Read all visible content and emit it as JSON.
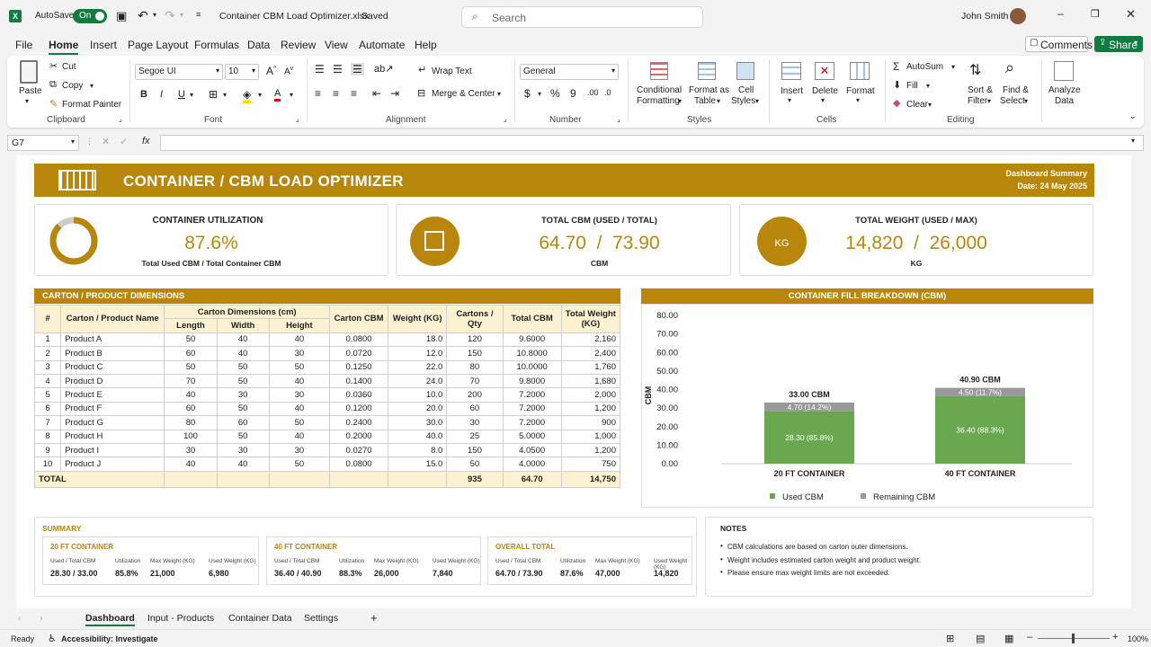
{
  "titlebar": {
    "autosave": "AutoSave",
    "toggle": "On",
    "filename": "Container CBM Load Optimizer.xlsx",
    "saved": "Saved",
    "search": "Search",
    "user": "John Smith"
  },
  "menu": [
    "File",
    "Home",
    "Insert",
    "Page Layout",
    "Formulas",
    "Data",
    "Review",
    "View",
    "Automate",
    "Help"
  ],
  "menu_actions": {
    "comments": "Comments",
    "share": "Share"
  },
  "ribbon": {
    "paste": "Paste",
    "cut": "Cut",
    "copy": "Copy",
    "format_painter": "Format Painter",
    "clipboard": "Clipboard",
    "font_name": "Segoe UI",
    "font_size": "10",
    "font": "Font",
    "wrap": "Wrap Text",
    "merge": "Merge & Center",
    "alignment": "Alignment",
    "number_format": "General",
    "number": "Number",
    "cond1": "Conditional",
    "cond2": "Formatting",
    "fat1": "Format as",
    "fat2": "Table",
    "cs1": "Cell",
    "cs2": "Styles",
    "styles": "Styles",
    "insert": "Insert",
    "delete": "Delete",
    "format": "Format",
    "cells": "Cells",
    "autosum": "AutoSum",
    "fill": "Fill",
    "clear": "Clear",
    "sort1": "Sort &",
    "sort2": "Filter",
    "find1": "Find &",
    "find2": "Select",
    "editing": "Editing",
    "analyze1": "Analyze",
    "analyze2": "Data"
  },
  "formula_bar": {
    "cell": "G7",
    "fx": "fx"
  },
  "dashboard": {
    "title": "CONTAINER / CBM LOAD OPTIMIZER",
    "summary_label": "Dashboard Summary",
    "date": "Date: 24 May 2025",
    "kpi": [
      {
        "title": "CONTAINER UTILIZATION",
        "value": "87.6%",
        "sub": "Total Used CBM / Total Container CBM",
        "pct": 0.876
      },
      {
        "title": "TOTAL CBM (USED / TOTAL)",
        "value": "64.70  /  73.90",
        "sub": "CBM",
        "icon": "box-icon"
      },
      {
        "title": "TOTAL WEIGHT (USED / MAX)",
        "value": "14,820  /  26,000",
        "sub": "KG",
        "icon": "weight-icon"
      }
    ],
    "carton_title": "CARTON / PRODUCT DIMENSIONS",
    "headers": {
      "num": "#",
      "name": "Carton / Product Name",
      "dims": "Carton Dimensions (cm)",
      "length": "Length",
      "width": "Width",
      "height": "Height",
      "cbm": "Carton CBM",
      "weight": "Weight (KG)",
      "qty": "Cartons / Qty",
      "tcbm": "Total CBM",
      "tweight": "Total Weight (KG)"
    },
    "rows": [
      [
        "1",
        "Product A",
        "50",
        "40",
        "40",
        "0.0800",
        "18.0",
        "120",
        "9.6000",
        "2,160"
      ],
      [
        "2",
        "Product B",
        "60",
        "40",
        "30",
        "0.0720",
        "12.0",
        "150",
        "10.8000",
        "2,400"
      ],
      [
        "3",
        "Product C",
        "50",
        "50",
        "50",
        "0.1250",
        "22.0",
        "80",
        "10.0000",
        "1,760"
      ],
      [
        "4",
        "Product D",
        "70",
        "50",
        "40",
        "0.1400",
        "24.0",
        "70",
        "9.8000",
        "1,680"
      ],
      [
        "5",
        "Product E",
        "40",
        "30",
        "30",
        "0.0360",
        "10.0",
        "200",
        "7.2000",
        "2,000"
      ],
      [
        "6",
        "Product F",
        "60",
        "50",
        "40",
        "0.1200",
        "20.0",
        "60",
        "7.2000",
        "1,200"
      ],
      [
        "7",
        "Product G",
        "80",
        "60",
        "50",
        "0.2400",
        "30.0",
        "30",
        "7.2000",
        "900"
      ],
      [
        "8",
        "Product H",
        "100",
        "50",
        "40",
        "0.2000",
        "40.0",
        "25",
        "5.0000",
        "1,000"
      ],
      [
        "9",
        "Product I",
        "30",
        "30",
        "30",
        "0.0270",
        "8.0",
        "150",
        "4.0500",
        "1,200"
      ],
      [
        "10",
        "Product J",
        "40",
        "40",
        "50",
        "0.0800",
        "15.0",
        "50",
        "4.0000",
        "750"
      ]
    ],
    "total": {
      "label": "TOTAL",
      "qty": "935",
      "cbm": "64.70",
      "weight": "14,750"
    },
    "chart_title": "CONTAINER FILL BREAKDOWN (CBM)",
    "summary": {
      "title": "SUMMARY",
      "blocks": [
        {
          "title": "20 FT CONTAINER",
          "h": [
            "Used / Total CBM",
            "Utilization",
            "Max Weight (KG)",
            "Used Weight (KG)"
          ],
          "v": [
            "28.30 / 33.00",
            "85.8%",
            "21,000",
            "6,980"
          ]
        },
        {
          "title": "40 FT CONTAINER",
          "h": [
            "Used / Total CBM",
            "Utilization",
            "Max Weight (KG)",
            "Used Weight (KG)"
          ],
          "v": [
            "36.40 / 40.90",
            "88.3%",
            "26,000",
            "7,840"
          ]
        },
        {
          "title": "OVERALL TOTAL",
          "h": [
            "Used / Total CBM",
            "Utilization",
            "Max Weight (KG)",
            "Used Weight (KG)"
          ],
          "v": [
            "64.70 / 73.90",
            "87.6%",
            "47,000",
            "14,820"
          ]
        }
      ]
    },
    "notes": {
      "title": "NOTES",
      "items": [
        "CBM calculations are based on carton outer dimensions.",
        "Weight includes estimated carton weight and product weight.",
        "Please ensure max weight limits are not exceeded."
      ]
    }
  },
  "chart_data": {
    "type": "bar",
    "stacked": true,
    "categories": [
      "20 FT CONTAINER",
      "40 FT CONTAINER"
    ],
    "series": [
      {
        "name": "Used CBM",
        "values": [
          28.3,
          36.4
        ],
        "labels": [
          "28.30 (85.8%)",
          "36.40 (88.3%)"
        ],
        "color": "#6aa84f"
      },
      {
        "name": "Remaining CBM",
        "values": [
          4.7,
          4.5
        ],
        "labels": [
          "4.70 (14.2%)",
          "4.50 (11.7%)"
        ],
        "color": "#999999"
      }
    ],
    "totals": [
      "33.00 CBM",
      "40.90 CBM"
    ],
    "ylabel": "CBM",
    "ylim": [
      0,
      80
    ],
    "yticks": [
      "0.00",
      "10.00",
      "20.00",
      "30.00",
      "40.00",
      "50.00",
      "60.00",
      "70.00",
      "80.00"
    ],
    "legend": "bottom"
  },
  "sheets": [
    "Dashboard",
    "Input - Products",
    "Container Data",
    "Settings"
  ],
  "status": {
    "ready": "Ready",
    "accessibility": "Accessibility: Investigate",
    "zoom": "100%"
  }
}
